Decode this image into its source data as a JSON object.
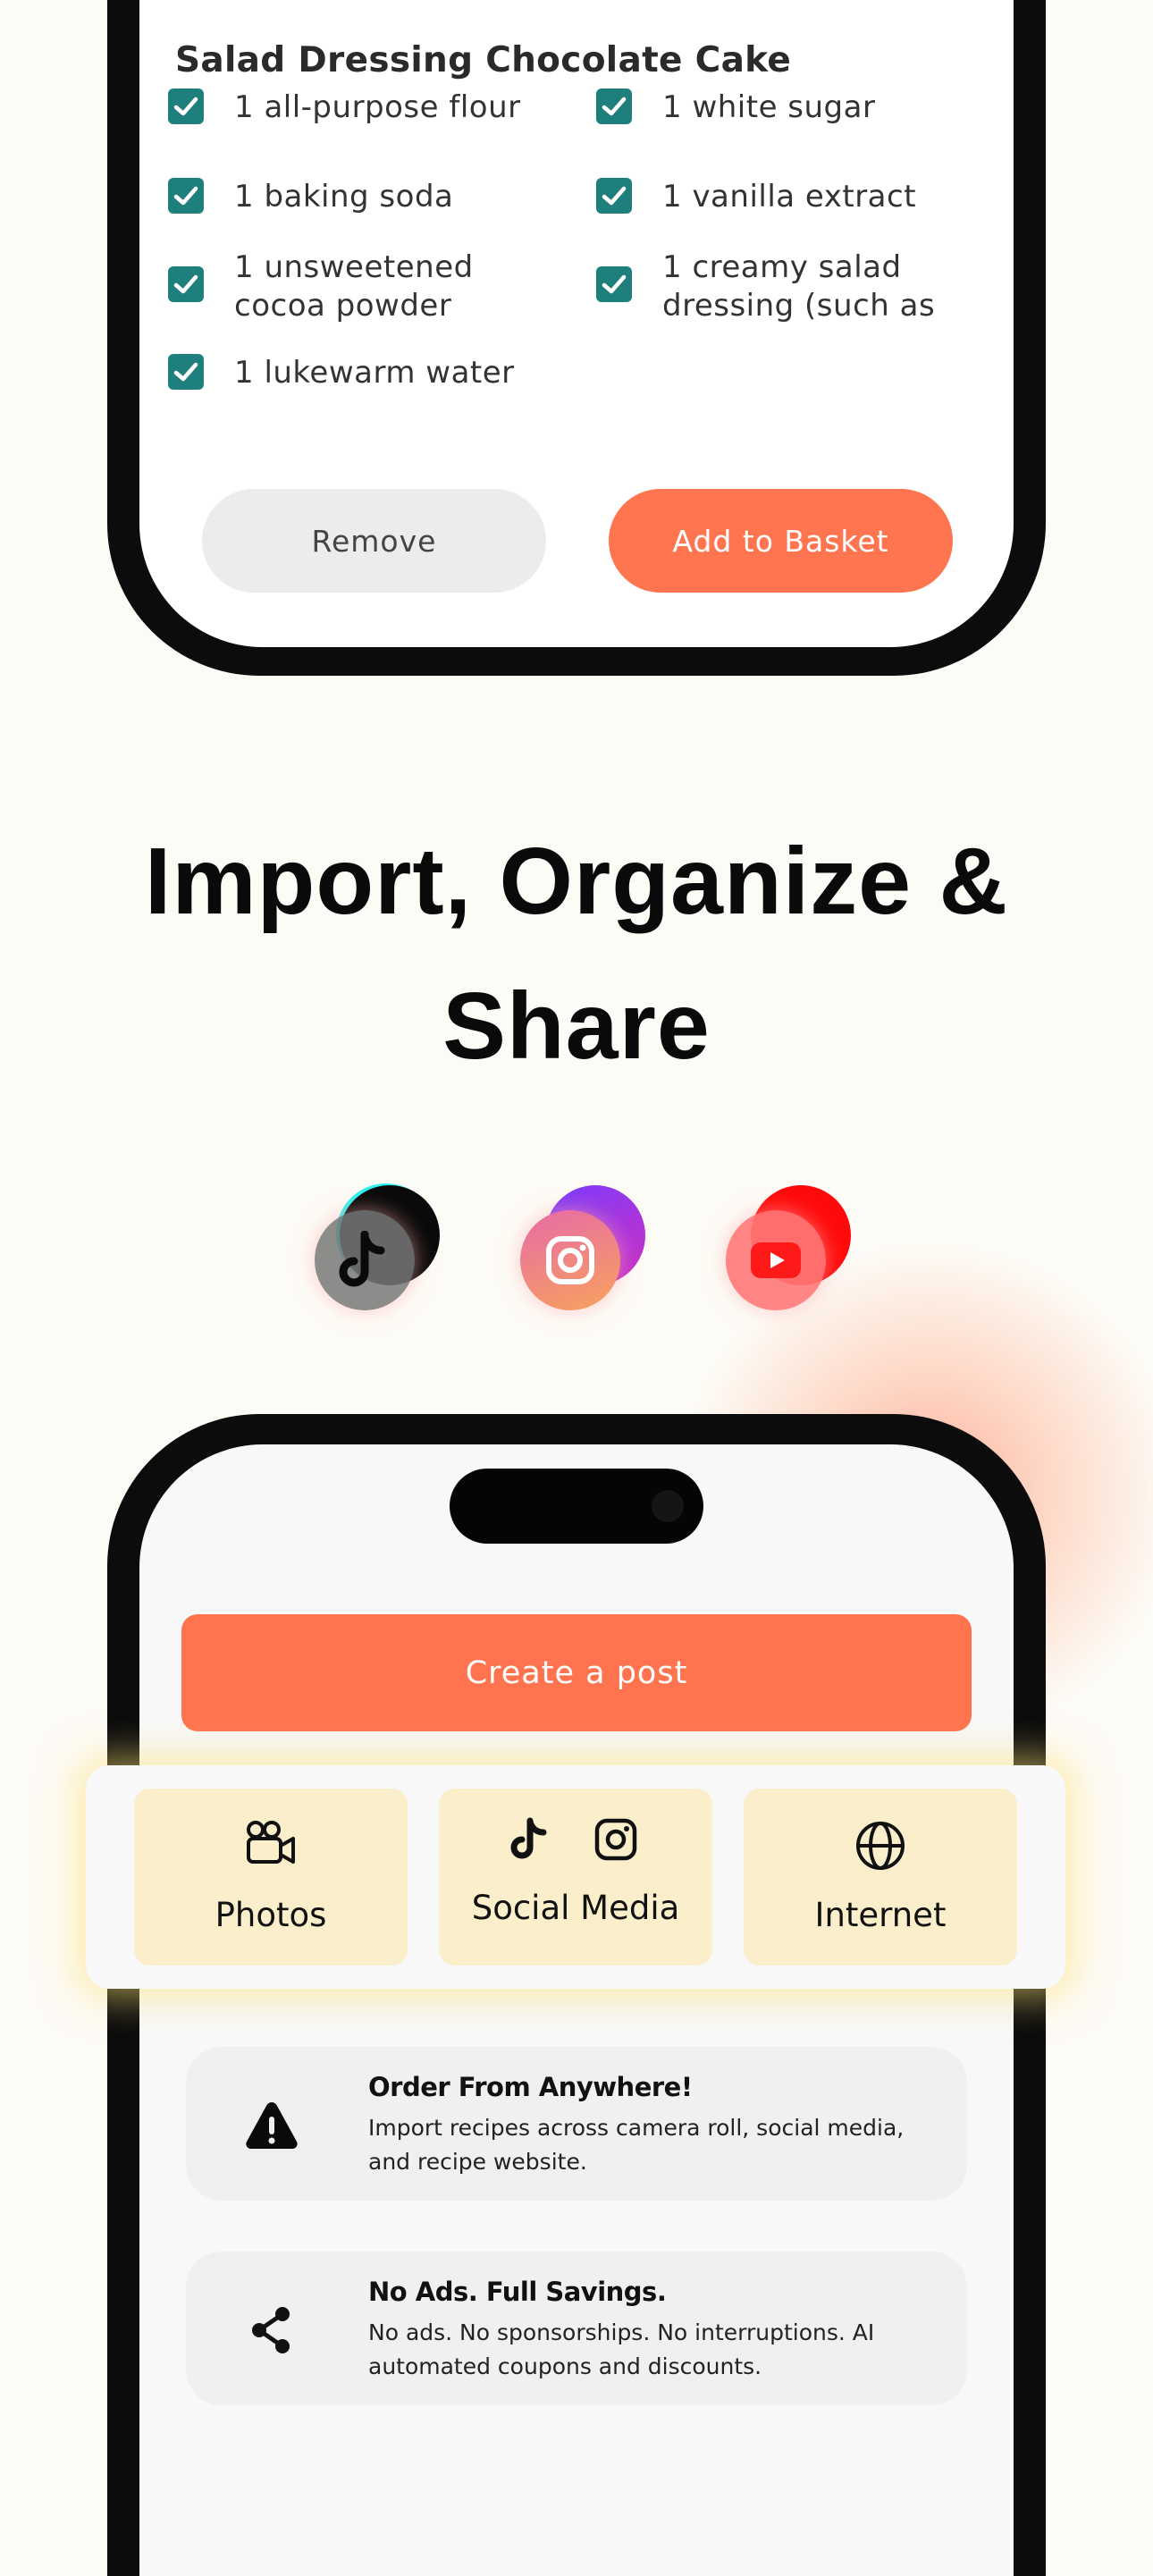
{
  "recipe_card": {
    "title": "Salad Dressing Chocolate Cake",
    "ingredients": [
      "1 all-purpose flour",
      "1 white sugar",
      "1 baking soda",
      "1 vanilla extract",
      "1 unsweetened cocoa powder",
      "1 creamy salad dressing (such as",
      "1 lukewarm water"
    ],
    "remove_label": "Remove",
    "add_label": "Add to Basket"
  },
  "headline": {
    "line1": "Import, Organize &",
    "line2": "Share"
  },
  "social_icons": [
    "tiktok-icon",
    "instagram-icon",
    "youtube-icon"
  ],
  "create_post": {
    "label": "Create a post"
  },
  "import_options": [
    {
      "label": "Photos",
      "icon": "video-camera-icon"
    },
    {
      "label": "Social Media",
      "icon": "tiktok-instagram-icon"
    },
    {
      "label": "Internet",
      "icon": "globe-icon"
    }
  ],
  "features": [
    {
      "title": "Order From Anywhere!",
      "desc": "Import recipes across camera roll, social media, and recipe website.",
      "icon": "warning-icon"
    },
    {
      "title": "No Ads. Full Savings.",
      "desc": "No ads. No sponsorships. No interruptions. AI automated coupons and discounts.",
      "icon": "share-icon"
    }
  ],
  "colors": {
    "accent": "#FF7550",
    "check": "#1E7F7C",
    "option_bg": "#FBEECB",
    "background": "#FDFBF6"
  }
}
